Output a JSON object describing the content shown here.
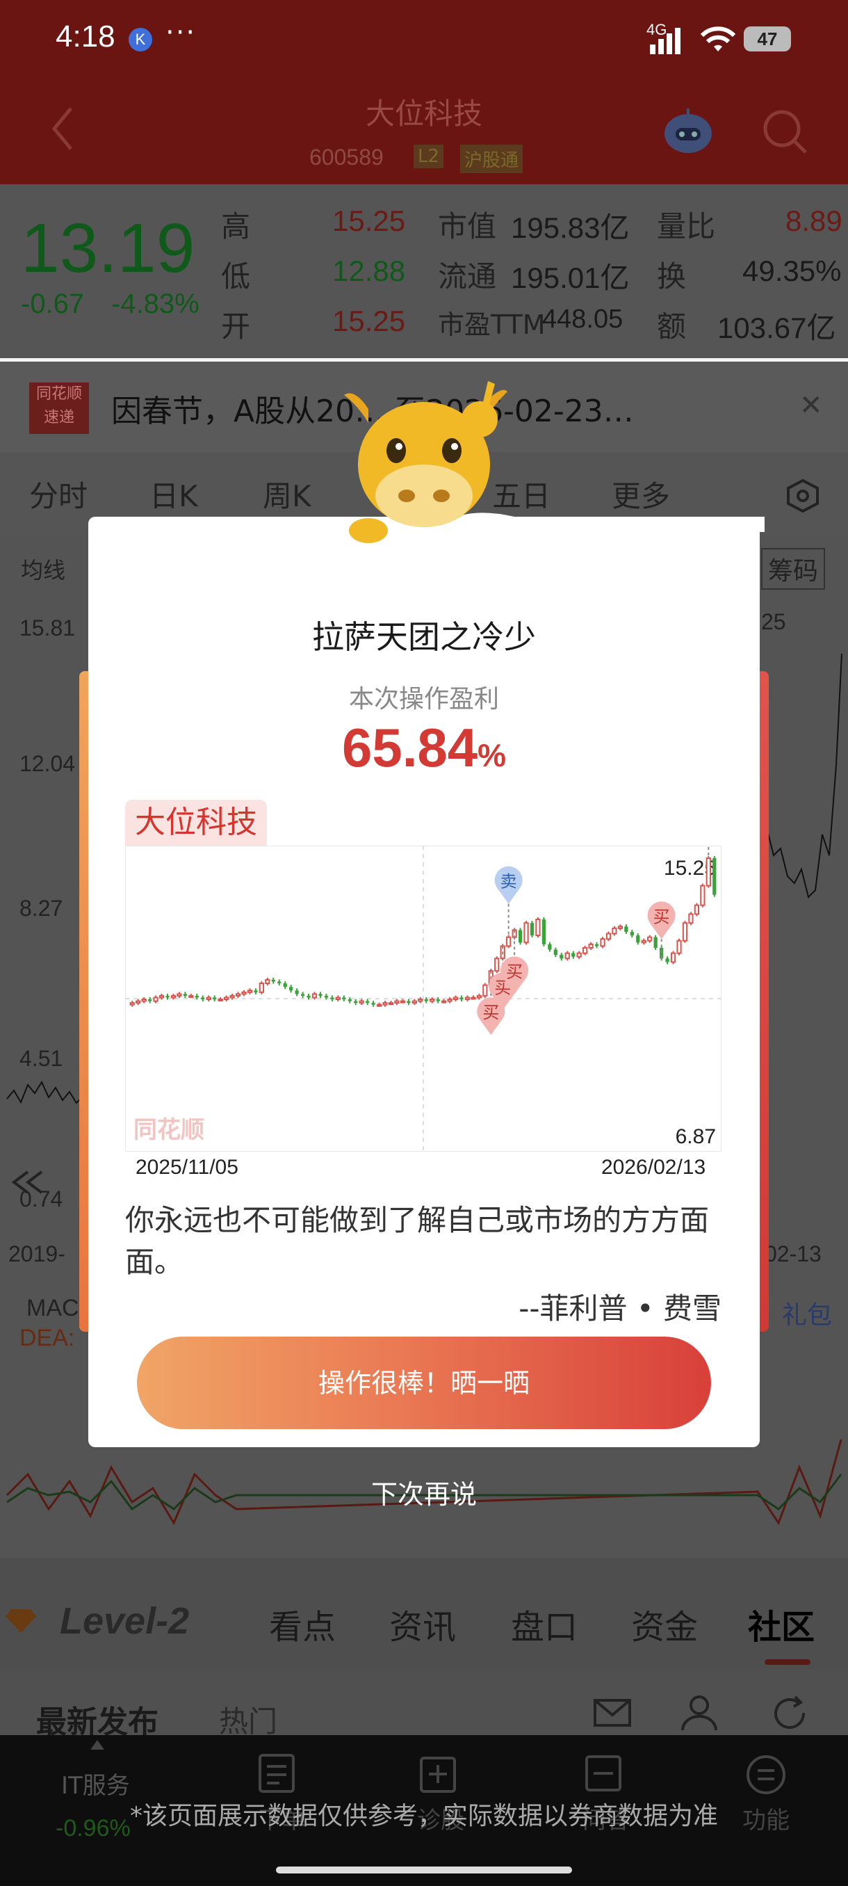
{
  "status_bar": {
    "time": "4:18",
    "badge": "K",
    "dots": "···",
    "network": "4G",
    "battery": "47"
  },
  "header": {
    "title": "大位科技",
    "code": "600589",
    "l2_tag": "L2",
    "hk_tag": "沪股通"
  },
  "quote": {
    "price": "13.19",
    "change": "-0.67",
    "change_pct": "-4.83%",
    "rows": [
      {
        "l1": "高",
        "v1": "15.25",
        "l2": "市值",
        "v2": "195.83亿",
        "l3": "量比",
        "v3": "8.89"
      },
      {
        "l1": "低",
        "v1": "12.88",
        "l2": "流通",
        "v2": "195.01亿",
        "l3": "换",
        "v3": "49.35%"
      },
      {
        "l1": "开",
        "v1": "15.25",
        "l2": "市盈TTM",
        "v2": "448.05",
        "l3": "额",
        "v3": "103.67亿"
      }
    ]
  },
  "news": {
    "logo_top": "同花顺",
    "logo_bottom": "速递",
    "text": "因春节，A股从20… 至2026-02-23…"
  },
  "tabs": {
    "items": [
      "分时",
      "日K",
      "周K",
      "五日",
      "更多"
    ],
    "indicator": "均线",
    "chip": "筹码"
  },
  "main_chart": {
    "labels_y": [
      "15.81",
      "12.04",
      "8.27",
      "4.51",
      "0.74"
    ],
    "date_left": "2019-",
    "date_right": "02-13",
    "macd": "MAC",
    "dea": "DEA:",
    "gift": "礼包",
    "right_val": "25"
  },
  "lower_tabs": [
    "Level-2",
    "看点",
    "资讯",
    "盘口",
    "资金",
    "社区"
  ],
  "feed": {
    "latest": "最新发布",
    "hot": "热门"
  },
  "bottom_nav": {
    "sector": "IT服务",
    "sector_change": "-0.96%",
    "items": [
      "下单",
      "诊股",
      "问答",
      "功能"
    ]
  },
  "popup": {
    "title": "拉萨天团之冷少",
    "subtitle": "本次操作盈利",
    "profit_value": "65.84",
    "profit_unit": "%",
    "stock_name": "大位科技",
    "quote": "你永远也不可能做到了解自己或市场的方方面面。",
    "author": "--菲利普 • 费雪",
    "share_button": "操作很棒！晒一晒",
    "later": "下次再说",
    "watermark": "同花顺"
  },
  "chart_data": {
    "type": "candlestick",
    "x_start": "2025/11/05",
    "x_end": "2026/02/13",
    "high_label": "15.25",
    "low_label": "6.87",
    "ylim": [
      6.87,
      15.25
    ],
    "closes": [
      7.1,
      7.2,
      7.3,
      7.2,
      7.4,
      7.5,
      7.4,
      7.5,
      7.6,
      7.5,
      7.5,
      7.4,
      7.3,
      7.4,
      7.3,
      7.3,
      7.4,
      7.5,
      7.6,
      7.7,
      7.8,
      7.7,
      8.2,
      8.4,
      8.3,
      8.2,
      8.0,
      7.8,
      7.6,
      7.5,
      7.4,
      7.6,
      7.5,
      7.4,
      7.3,
      7.4,
      7.3,
      7.2,
      7.1,
      7.2,
      7.1,
      7.0,
      7.0,
      7.1,
      7.1,
      7.2,
      7.2,
      7.1,
      7.2,
      7.3,
      7.2,
      7.3,
      7.2,
      7.2,
      7.3,
      7.4,
      7.3,
      7.4,
      7.4,
      7.5,
      8.1,
      8.9,
      9.6,
      10.3,
      10.8,
      11.2,
      10.5,
      11.6,
      10.9,
      11.8,
      10.4,
      10.1,
      9.8,
      9.6,
      9.9,
      9.7,
      9.9,
      10.2,
      10.4,
      10.3,
      10.7,
      11.0,
      11.3,
      11.4,
      11.1,
      10.9,
      10.5,
      10.6,
      10.8,
      10.2,
      9.6,
      9.4,
      9.9,
      10.6,
      11.6,
      12.1,
      12.6,
      13.7,
      15.25,
      13.19
    ],
    "markers": [
      {
        "type": "买",
        "index": 61
      },
      {
        "type": "买",
        "index": 63
      },
      {
        "type": "卖",
        "index": 64
      },
      {
        "type": "买",
        "index": 65
      },
      {
        "type": "买",
        "index": 90
      },
      {
        "type": "卖",
        "index": 98
      }
    ]
  },
  "colors": {
    "up": "#d9544d",
    "down": "#3aa33a",
    "accent": "#d23a33",
    "header_bg": "#6b1513"
  }
}
